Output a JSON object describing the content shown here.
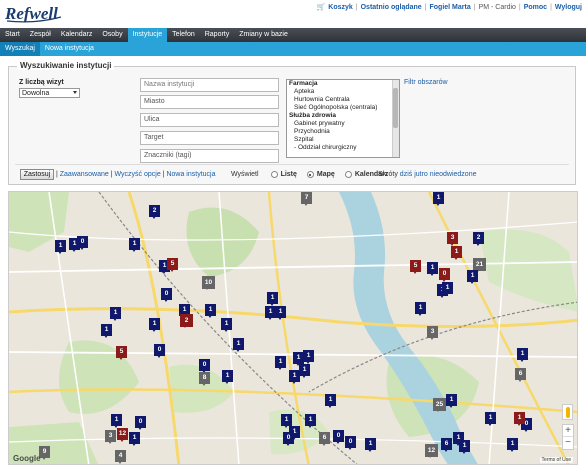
{
  "app": {
    "logo_text": "Refwell"
  },
  "toplinks": {
    "cart": "Koszyk",
    "recent": "Ostatnio oglądane",
    "user": "Fogiel Marta",
    "context": "PM - Cardio",
    "help": "Pomoc",
    "logout": "Wyloguj"
  },
  "mainnav": [
    {
      "label": "Start"
    },
    {
      "label": "Zespół"
    },
    {
      "label": "Kalendarz"
    },
    {
      "label": "Osoby"
    },
    {
      "label": "Instytucje",
      "active": true
    },
    {
      "label": "Telefon"
    },
    {
      "label": "Raporty"
    },
    {
      "label": "Zmiany w bazie"
    }
  ],
  "subnav": [
    {
      "label": "Wyszukaj",
      "active": true
    },
    {
      "label": "Nowa instytucja"
    }
  ],
  "search": {
    "title": "Wyszukiwanie instytucji",
    "count_label": "Z liczbą wizyt",
    "count_value": "Dowolna",
    "name_placeholder": "Nazwa instytucji",
    "city_placeholder": "Miasto",
    "street_placeholder": "Ulica",
    "target_placeholder": "Target",
    "tags_placeholder": "Znaczniki (tagi)",
    "filter_link": "Filtr obszarów",
    "type_options": [
      {
        "label": "Farmacja",
        "kind": "group"
      },
      {
        "label": "Apteka",
        "kind": "child"
      },
      {
        "label": "Hurtownia Centrala",
        "kind": "child"
      },
      {
        "label": "Sieć Ogólnopolska (centrala)",
        "kind": "child"
      },
      {
        "label": "Służba zdrowia",
        "kind": "group"
      },
      {
        "label": "Gabinet prywatny",
        "kind": "child"
      },
      {
        "label": "Przychodnia",
        "kind": "child"
      },
      {
        "label": "Szpital",
        "kind": "child"
      },
      {
        "label": "- Oddział chirurgiczny",
        "kind": "child"
      }
    ],
    "apply_label": "Zastosuj",
    "advanced_label": "Zaawansowane",
    "clear_label": "Wyczyść opcje",
    "new_label": "Nowa instytucja",
    "view_label": "Wyświetl",
    "view_list": "Listę",
    "view_map": "Mapę",
    "view_calendar": "Kalendarz",
    "view_selected": "map",
    "shortcuts_label": "Skróty",
    "shortcut_today": "dziś",
    "shortcut_tomorrow": "jutro",
    "shortcut_unvisited": "nieodwiedzone"
  },
  "map": {
    "google_label": "Google",
    "terms_label": "Terms of Use",
    "zoom_in": "+",
    "zoom_out": "−",
    "markers": [
      {
        "label": "1",
        "color": "navy"
      },
      {
        "label": "1",
        "color": "navy"
      },
      {
        "label": "2",
        "color": "navy"
      },
      {
        "label": "1",
        "color": "navy"
      },
      {
        "label": "0",
        "color": "navy"
      },
      {
        "label": "1",
        "color": "navy"
      },
      {
        "label": "1",
        "color": "navy"
      },
      {
        "label": "5",
        "color": "red"
      },
      {
        "label": "7",
        "color": "gray"
      },
      {
        "label": "10",
        "color": "gray"
      },
      {
        "label": "0",
        "color": "navy"
      },
      {
        "label": "1",
        "color": "navy"
      },
      {
        "label": "1",
        "color": "navy"
      },
      {
        "label": "2",
        "color": "red"
      },
      {
        "label": "1",
        "color": "navy"
      },
      {
        "label": "1",
        "color": "navy"
      },
      {
        "label": "1",
        "color": "navy"
      },
      {
        "label": "1",
        "color": "navy"
      },
      {
        "label": "1",
        "color": "navy"
      },
      {
        "label": "1",
        "color": "navy"
      },
      {
        "label": "1",
        "color": "navy"
      },
      {
        "label": "0",
        "color": "navy"
      },
      {
        "label": "5",
        "color": "red"
      },
      {
        "label": "1",
        "color": "navy"
      },
      {
        "label": "0",
        "color": "navy"
      },
      {
        "label": "8",
        "color": "gray"
      },
      {
        "label": "1",
        "color": "navy"
      },
      {
        "label": "1",
        "color": "navy"
      },
      {
        "label": "1",
        "color": "navy"
      },
      {
        "label": "1",
        "color": "navy"
      },
      {
        "label": "1",
        "color": "navy"
      },
      {
        "label": "1",
        "color": "navy"
      },
      {
        "label": "1",
        "color": "navy"
      },
      {
        "label": "1",
        "color": "navy"
      },
      {
        "label": "1",
        "color": "navy"
      },
      {
        "label": "3",
        "color": "red"
      },
      {
        "label": "1",
        "color": "red"
      },
      {
        "label": "2",
        "color": "navy"
      },
      {
        "label": "21",
        "color": "gray"
      },
      {
        "label": "5",
        "color": "red"
      },
      {
        "label": "1",
        "color": "navy"
      },
      {
        "label": "0",
        "color": "red"
      },
      {
        "label": "1",
        "color": "navy"
      },
      {
        "label": "1",
        "color": "navy"
      },
      {
        "label": "1",
        "color": "navy"
      },
      {
        "label": "1",
        "color": "navy"
      },
      {
        "label": "3",
        "color": "gray"
      },
      {
        "label": "1",
        "color": "navy"
      },
      {
        "label": "6",
        "color": "gray"
      },
      {
        "label": "25",
        "color": "gray"
      },
      {
        "label": "1",
        "color": "navy"
      },
      {
        "label": "1",
        "color": "navy"
      },
      {
        "label": "0",
        "color": "navy"
      },
      {
        "label": "12",
        "color": "red"
      },
      {
        "label": "3",
        "color": "gray"
      },
      {
        "label": "1",
        "color": "navy"
      },
      {
        "label": "9",
        "color": "gray"
      },
      {
        "label": "4",
        "color": "gray"
      },
      {
        "label": "1",
        "color": "navy"
      },
      {
        "label": "0",
        "color": "navy"
      },
      {
        "label": "6",
        "color": "gray"
      },
      {
        "label": "0",
        "color": "navy"
      },
      {
        "label": "0",
        "color": "navy"
      },
      {
        "label": "1",
        "color": "navy"
      },
      {
        "label": "1",
        "color": "navy"
      },
      {
        "label": "12",
        "color": "gray"
      },
      {
        "label": "6",
        "color": "navy"
      },
      {
        "label": "1",
        "color": "navy"
      },
      {
        "label": "1",
        "color": "navy"
      },
      {
        "label": "0",
        "color": "navy"
      },
      {
        "label": "1",
        "color": "red"
      },
      {
        "label": "1",
        "color": "navy"
      }
    ]
  }
}
